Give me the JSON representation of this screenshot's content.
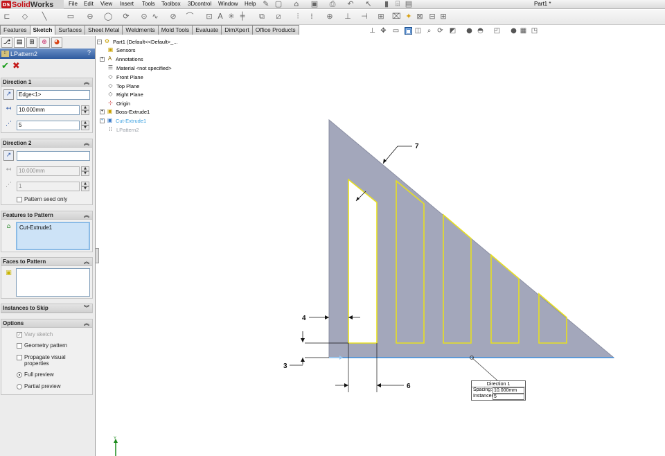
{
  "app": {
    "brand_ds": "DS",
    "brand_name_bold": "Solid",
    "brand_name_rest": "Works",
    "document_title": "Part1 *"
  },
  "menu": {
    "items": [
      "File",
      "Edit",
      "View",
      "Insert",
      "Tools",
      "Toolbox",
      "3Dcontrol",
      "Window",
      "Help"
    ]
  },
  "command_tabs": {
    "items": [
      "Features",
      "Sketch",
      "Surfaces",
      "Sheet Metal",
      "Weldments",
      "Mold Tools",
      "Evaluate",
      "DimXpert",
      "Office Products"
    ],
    "active": "Sketch"
  },
  "property_manager": {
    "title": "LPattern2",
    "help": "?",
    "ok_symbol": "✔",
    "cancel_symbol": "✖",
    "direction1": {
      "title": "Direction 1",
      "edge": "Edge<1>",
      "spacing": "10.000mm",
      "instances": "5"
    },
    "direction2": {
      "title": "Direction 2",
      "edge": "",
      "spacing": "10.000mm",
      "instances": "1",
      "pattern_seed_only": "Pattern seed only"
    },
    "features_to_pattern": {
      "title": "Features to Pattern",
      "items": [
        "Cut-Extrude1"
      ]
    },
    "faces_to_pattern": {
      "title": "Faces to Pattern"
    },
    "instances_to_skip": {
      "title": "Instances to Skip"
    },
    "options": {
      "title": "Options",
      "vary_sketch": "Vary sketch",
      "geometry_pattern": "Geometry pattern",
      "propagate_visual": "Propagate visual properties",
      "full_preview": "Full preview",
      "partial_preview": "Partial preview"
    }
  },
  "feature_tree": {
    "root": "Part1  (Default<<Default>_...",
    "items": [
      {
        "label": "Sensors",
        "icon": "sensor-icon"
      },
      {
        "label": "Annotations",
        "icon": "annotations-icon"
      },
      {
        "label": "Material <not specified>",
        "icon": "material-icon"
      },
      {
        "label": "Front Plane",
        "icon": "plane-icon"
      },
      {
        "label": "Top Plane",
        "icon": "plane-icon"
      },
      {
        "label": "Right Plane",
        "icon": "plane-icon"
      },
      {
        "label": "Origin",
        "icon": "origin-icon"
      },
      {
        "label": "Boss-Extrude1",
        "icon": "boss-extrude-icon"
      },
      {
        "label": "Cut-Extrude1",
        "icon": "cut-extrude-icon"
      },
      {
        "label": "LPattern2",
        "icon": "linear-pattern-icon"
      }
    ]
  },
  "graphics": {
    "balloons": [
      "7",
      "4",
      "3",
      "6"
    ],
    "callout": {
      "title": "Direction 1",
      "spacing_label": "Spacing:",
      "spacing_value": "10.000mm",
      "instances_label": "Instances:",
      "instances_value": "5"
    },
    "triad_label": "Y"
  },
  "colors": {
    "part_fill": "#a3a7bb",
    "preview_outline": "#e8e020",
    "pm_header": "#2f5b9e",
    "selection_edge": "#3a8ad8"
  }
}
